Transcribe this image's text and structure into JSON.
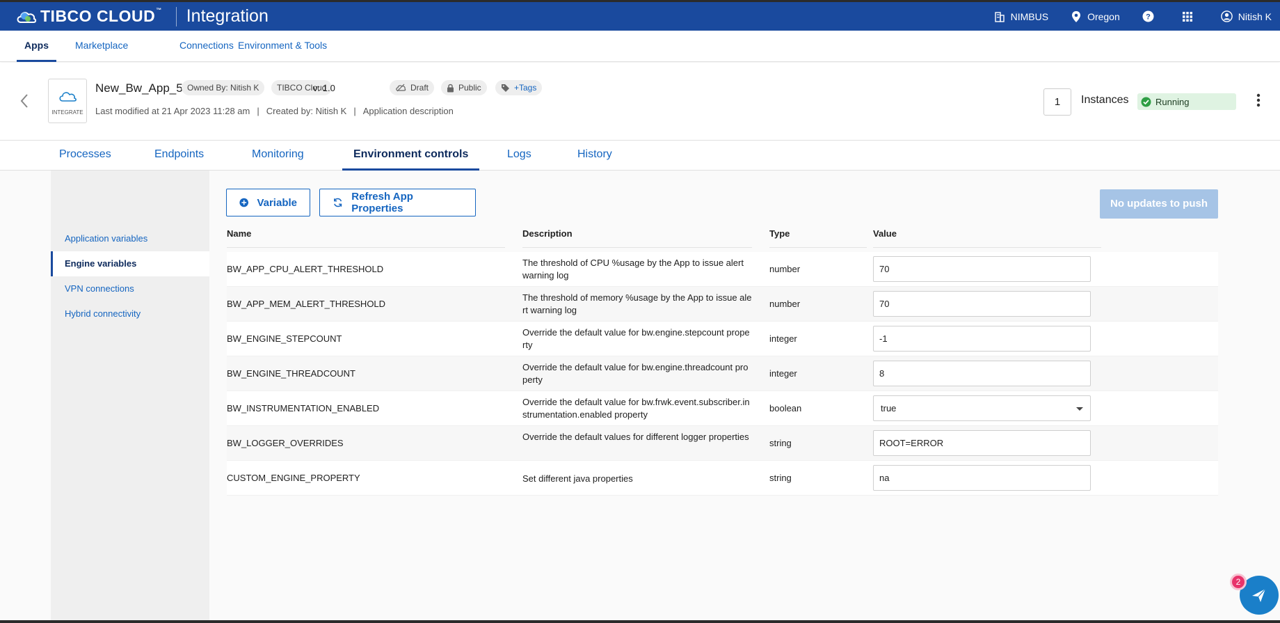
{
  "header": {
    "brand": "TIBCO CLOUD",
    "brand_tm": "™",
    "product": "Integration",
    "org": "NIMBUS",
    "region": "Oregon",
    "user": "Nitish K",
    "colors": {
      "header_bg": "#1a4a9e",
      "link": "#1565c0",
      "running_bg": "#dff3e2",
      "running_icon": "#2e9e44"
    }
  },
  "nav": {
    "items": [
      {
        "label": "Apps",
        "active": true
      },
      {
        "label": "Marketplace"
      },
      {
        "label": "Connections"
      },
      {
        "label": "Environment & Tools"
      }
    ]
  },
  "app": {
    "tile_label": "INTEGRATE",
    "name": "New_Bw_App_5",
    "owner": "Owned By:  Nitish K",
    "platform": "TIBCO Cloud",
    "version": "v: 1.0",
    "draft": "Draft",
    "visibility": "Public",
    "tags": "+Tags",
    "last_modified": "Last modified at 21 Apr 2023 11:28 am",
    "created_by": "Created by: Nitish K",
    "description": "Application description",
    "instances_count": "1",
    "instances_label": "Instances",
    "status": "Running"
  },
  "tabs": [
    {
      "label": "Processes"
    },
    {
      "label": "Endpoints"
    },
    {
      "label": "Monitoring"
    },
    {
      "label": "Environment controls",
      "active": true
    },
    {
      "label": "Logs"
    },
    {
      "label": "History"
    }
  ],
  "sidebar": {
    "items": [
      {
        "label": "Application variables"
      },
      {
        "label": "Engine variables",
        "active": true
      },
      {
        "label": "VPN connections"
      },
      {
        "label": "Hybrid connectivity"
      }
    ]
  },
  "toolbar": {
    "variable_label": "Variable",
    "refresh_label": "Refresh App Properties",
    "push_label": "No updates to push"
  },
  "table": {
    "headers": {
      "name": "Name",
      "description": "Description",
      "type": "Type",
      "value": "Value"
    },
    "rows": [
      {
        "name": "BW_APP_CPU_ALERT_THRESHOLD",
        "description": "The threshold of CPU %usage by the App to issue alert warning log",
        "type": "number",
        "value": "70"
      },
      {
        "name": "BW_APP_MEM_ALERT_THRESHOLD",
        "description": "The threshold of memory %usage by the App to issue alert warning log",
        "type": "number",
        "value": "70"
      },
      {
        "name": "BW_ENGINE_STEPCOUNT",
        "description": "Override the default value for bw.engine.stepcount property",
        "type": "integer",
        "value": "-1"
      },
      {
        "name": "BW_ENGINE_THREADCOUNT",
        "description": "Override the default value for bw.engine.threadcount property",
        "type": "integer",
        "value": "8"
      },
      {
        "name": "BW_INSTRUMENTATION_ENABLED",
        "description": "Override the default value for bw.frwk.event.subscriber.instrumentation.enabled property",
        "type": "boolean",
        "value": "true"
      },
      {
        "name": "BW_LOGGER_OVERRIDES",
        "description": "Override the default values for different logger properties",
        "type": "string",
        "value": "ROOT=ERROR"
      },
      {
        "name": "CUSTOM_ENGINE_PROPERTY",
        "description": "Set different java properties",
        "type": "string",
        "value": "na"
      }
    ]
  },
  "help": {
    "badge_count": "2"
  }
}
